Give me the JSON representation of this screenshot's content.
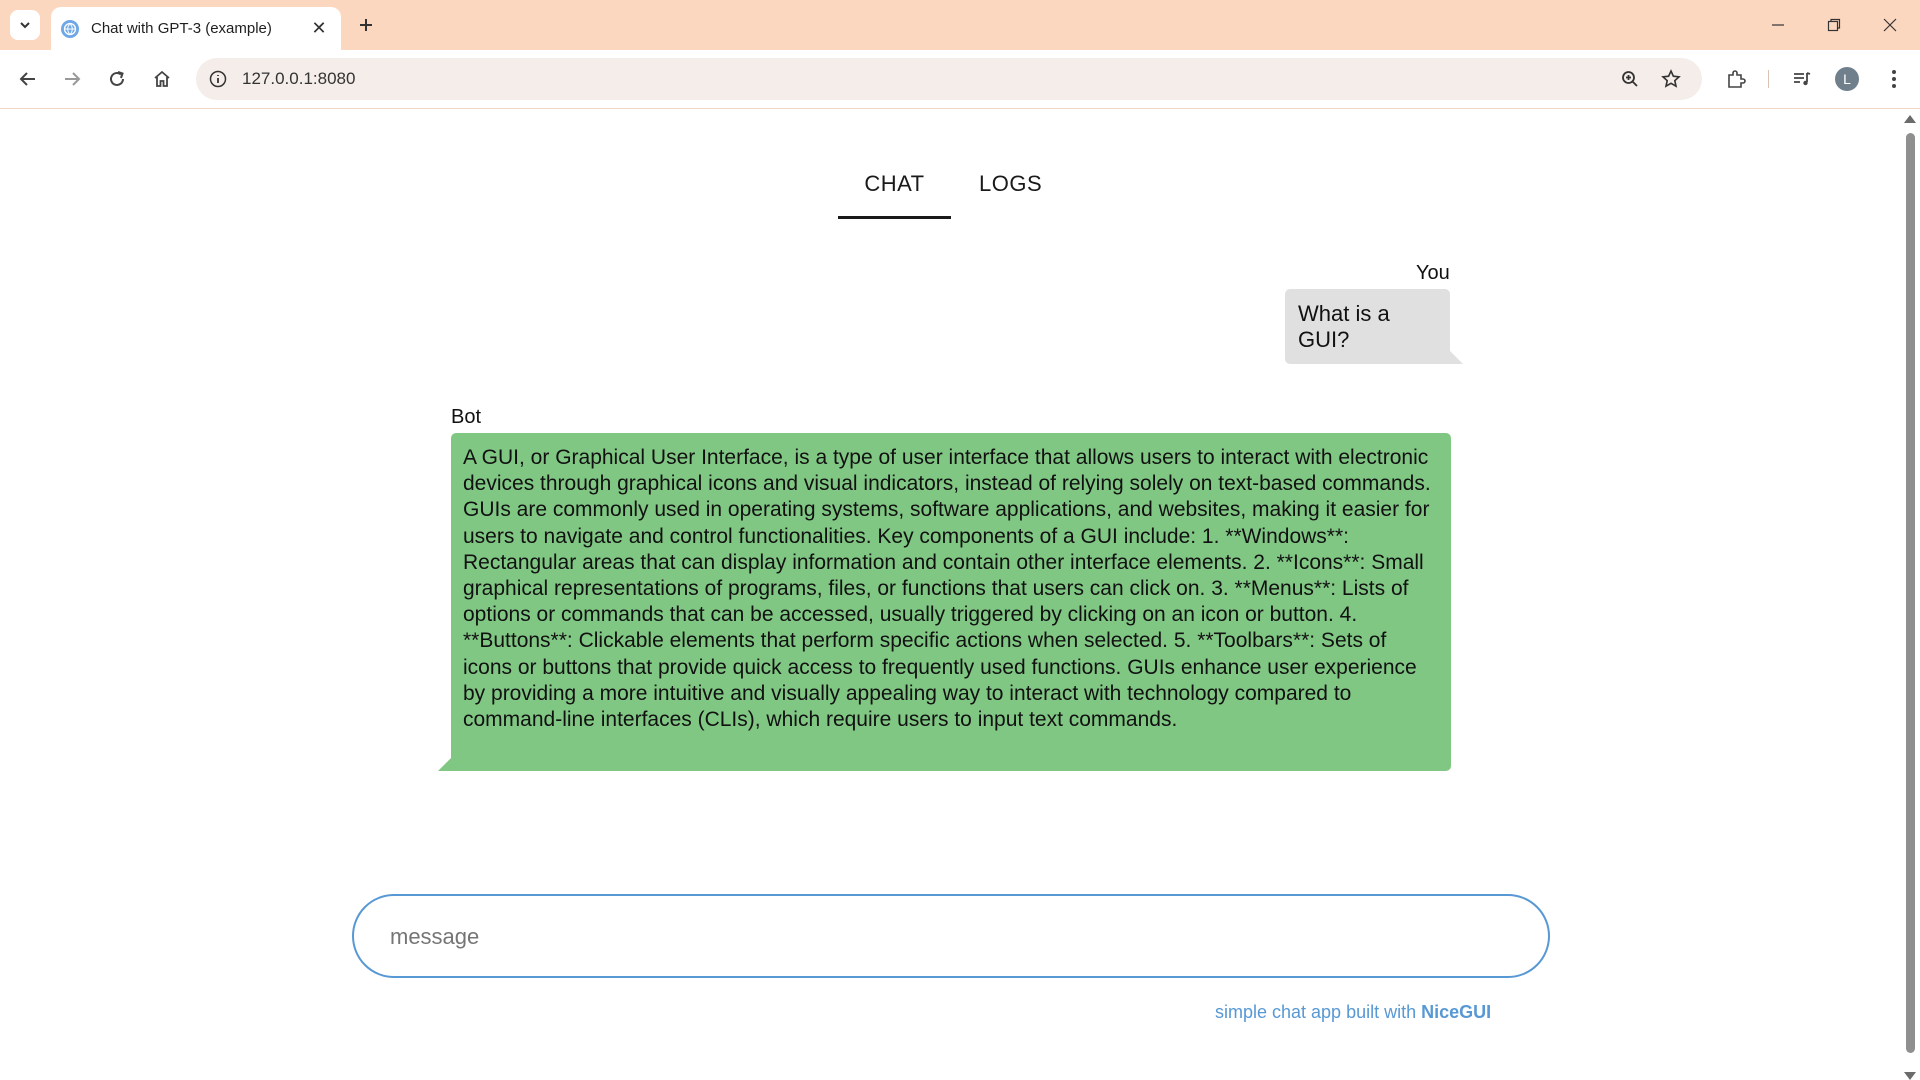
{
  "browser": {
    "tab_title": "Chat with GPT-3 (example)",
    "url": "127.0.0.1:8080",
    "profile_initial": "L"
  },
  "app": {
    "tabs": [
      {
        "label": "CHAT",
        "active": true
      },
      {
        "label": "LOGS",
        "active": false
      }
    ],
    "messages": [
      {
        "sender": "You",
        "text": "What is a GUI?"
      },
      {
        "sender": "Bot",
        "text": "A GUI, or Graphical User Interface, is a type of user interface that allows users to interact with electronic devices through graphical icons and visual indicators, instead of relying solely on text-based commands. GUIs are commonly used in operating systems, software applications, and websites, making it easier for users to navigate and control functionalities. Key components of a GUI include: 1. **Windows**: Rectangular areas that can display information and contain other interface elements. 2. **Icons**: Small graphical representations of programs, files, or functions that users can click on. 3. **Menus**: Lists of options or commands that can be accessed, usually triggered by clicking on an icon or button. 4. **Buttons**: Clickable elements that perform specific actions when selected. 5. **Toolbars**: Sets of icons or buttons that provide quick access to frequently used functions. GUIs enhance user experience by providing a more intuitive and visually appealing way to interact with technology compared to command-line interfaces (CLIs), which require users to input text commands."
      }
    ],
    "input": {
      "placeholder": "message",
      "value": ""
    },
    "footer": {
      "text": "simple chat app built with",
      "link": "NiceGUI"
    }
  },
  "colors": {
    "accent": "#5898d4",
    "bot_bubble": "#81c784",
    "user_bubble": "#e0e0e0",
    "titlebar": "#fcd7c0"
  }
}
